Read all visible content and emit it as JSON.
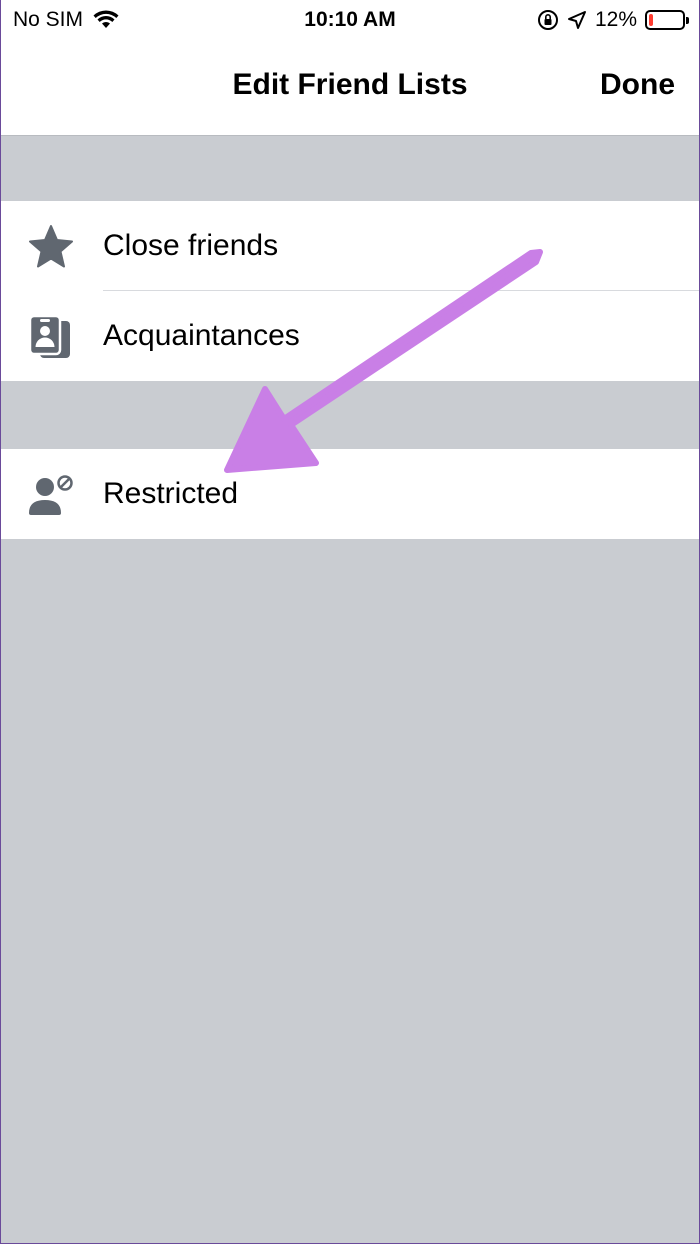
{
  "status_bar": {
    "carrier": "No SIM",
    "time": "10:10 AM",
    "battery_percent": "12%",
    "battery_level": 0.12,
    "icons": [
      "wifi-icon",
      "orientation-lock-icon",
      "location-icon",
      "battery-icon"
    ]
  },
  "nav": {
    "title": "Edit Friend Lists",
    "done_label": "Done"
  },
  "lists": {
    "group1": [
      {
        "label": "Close friends",
        "icon": "star-icon"
      },
      {
        "label": "Acquaintances",
        "icon": "id-cards-icon"
      }
    ],
    "group2": [
      {
        "label": "Restricted",
        "icon": "restricted-person-icon"
      }
    ]
  },
  "colors": {
    "background": "#c9ccd1",
    "icon": "#606770",
    "annotation_arrow": "#c97fe6",
    "battery_low": "#ff3b30"
  }
}
